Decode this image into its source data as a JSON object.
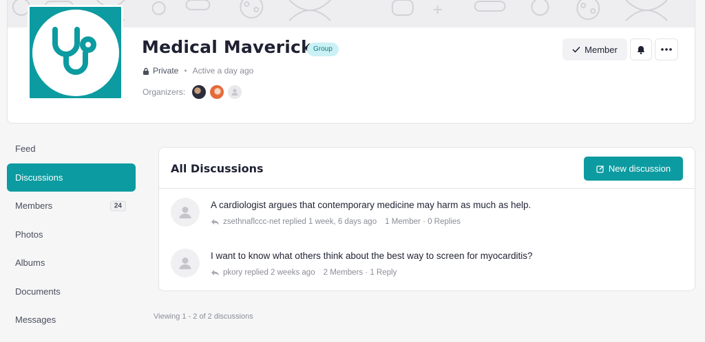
{
  "group": {
    "name": "Medical Mavericks",
    "type_badge": "Group",
    "privacy": "Private",
    "activity": "Active a day ago",
    "organizers_label": "Organizers:"
  },
  "actions": {
    "member_label": "Member",
    "bell_icon": "bell-icon",
    "more_icon": "more-icon"
  },
  "sidebar": {
    "items": [
      {
        "label": "Feed"
      },
      {
        "label": "Discussions",
        "active": true
      },
      {
        "label": "Members",
        "count": "24"
      },
      {
        "label": "Photos"
      },
      {
        "label": "Albums"
      },
      {
        "label": "Documents"
      },
      {
        "label": "Messages"
      }
    ]
  },
  "discussions": {
    "title": "All Discussions",
    "new_button": "New discussion",
    "topics": [
      {
        "title": "A cardiologist argues that contemporary medicine may harm as much as help.",
        "reply_info": "zsethnaflccc-net replied 1 week, 6 days ago",
        "stats": "1 Member · 0 Replies"
      },
      {
        "title": "I want to know what others think about the best way to screen for myocarditis?",
        "reply_info": "pkory replied 2 weeks ago",
        "stats": "2 Members · 1 Reply"
      }
    ],
    "footer": "Viewing 1 - 2 of 2 discussions"
  },
  "colors": {
    "accent": "#0c9ba0",
    "badge_bg": "#cbf1f5",
    "badge_text": "#0c7c85"
  }
}
